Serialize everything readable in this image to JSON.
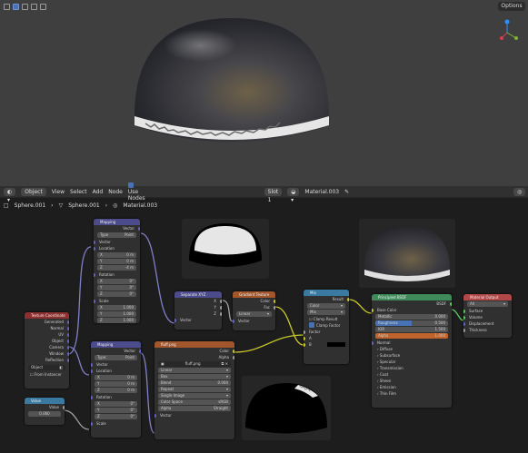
{
  "viewport": {
    "options_label": "Options"
  },
  "header": {
    "mode": "Object",
    "menus": [
      "View",
      "Select",
      "Add",
      "Node"
    ],
    "use_nodes": "Use Nodes",
    "slot": "Slot 1",
    "material": "Material.003"
  },
  "breadcrumb": {
    "object": "Sphere.001",
    "mesh": "Sphere.001",
    "material": "Material.003"
  },
  "nodes": {
    "mapping1": {
      "title": "Mapping",
      "out": "Vector",
      "type_label": "Type",
      "type": "Point",
      "vector": "Vector",
      "location": "Location",
      "lx": "0 m",
      "ly": "0 m",
      "lz": "-4 m",
      "rotation": "Rotation",
      "rx": "0°",
      "ry": "0°",
      "rz": "0°",
      "scale": "Scale",
      "sx": "1.000",
      "sy": "1.000",
      "sz": "1.000",
      "X": "X",
      "Y": "Y",
      "Z": "Z"
    },
    "texcoord": {
      "title": "Texture Coordinate",
      "outs": [
        "Generated",
        "Normal",
        "UV",
        "Object",
        "Camera",
        "Window",
        "Reflection"
      ],
      "object_label": "Object",
      "from_instancer": "From Instancer"
    },
    "mapping2": {
      "title": "Mapping",
      "out": "Vector",
      "type_label": "Type:",
      "type": "Point",
      "vector": "Vector",
      "location": "Location",
      "lx": "0 m",
      "ly": "0 m",
      "lz": "0 m",
      "rotation": "Rotation",
      "rx": "0°",
      "ry": "0°",
      "rz": "0°",
      "scale": "Scale"
    },
    "value": {
      "title": "Value",
      "out": "Value",
      "val": "0.060"
    },
    "sepxyz": {
      "title": "Separate XYZ",
      "outs": [
        "X",
        "Y",
        "Z"
      ],
      "in": "Vector"
    },
    "gradient": {
      "title": "Gradient Texture",
      "outs": [
        "Color",
        "Fac"
      ],
      "type": "Linear",
      "in": "Vector"
    },
    "image": {
      "title": "fluff.png",
      "outs": [
        "Color",
        "Alpha"
      ],
      "file": "fluff.png",
      "interp": "Linear",
      "proj": "Box",
      "blend_label": "Blend",
      "blend": "0.000",
      "ext": "Repeat",
      "src": "Single Image",
      "cs_label": "Color Space",
      "cs": "sRGB",
      "alpha_label": "Alpha",
      "alpha": "Straight",
      "in": "Vector"
    },
    "mix": {
      "title": "Mix",
      "out": "Result",
      "dtype": "Color",
      "blend": "Mix",
      "clamp_result": "Clamp Result",
      "clamp_factor": "Clamp Factor",
      "factor": "Factor",
      "a": "A",
      "b": "B"
    },
    "bsdf": {
      "title": "Principled BSDF",
      "out": "BSDF",
      "base_color": "Base Color",
      "metallic_label": "Metallic",
      "metallic": "0.000",
      "rough_label": "Roughness",
      "rough": "0.500",
      "ior_label": "IOR",
      "ior": "1.500",
      "alpha_label": "Alpha",
      "alpha": "1.000",
      "normal": "Normal",
      "panels": [
        "Diffuse",
        "Subsurface",
        "Specular",
        "Transmission",
        "Coat",
        "Sheen",
        "Emission",
        "Thin Film"
      ]
    },
    "output": {
      "title": "Material Output",
      "target": "All",
      "ins": [
        "Surface",
        "Volume",
        "Displacement",
        "Thickness"
      ]
    }
  },
  "colors": {
    "vector": "#6363c7",
    "color": "#c7c729",
    "float": "#a1a1a1",
    "shader": "#63c763"
  }
}
